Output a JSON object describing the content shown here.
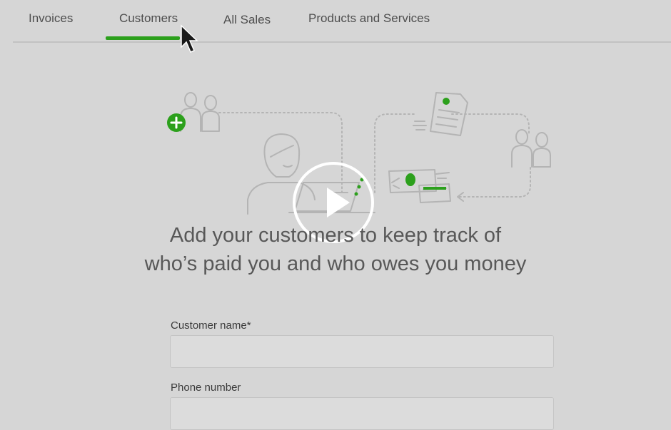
{
  "tabs": [
    {
      "label": "Invoices",
      "active": false
    },
    {
      "label": "Customers",
      "active": true
    },
    {
      "label": "All Sales",
      "active": false
    },
    {
      "label": "Products and Services",
      "active": false
    }
  ],
  "colors": {
    "accent": "#2ca01c",
    "background": "#d6d6d6"
  },
  "icons": [
    "add-customer-icon",
    "customers-icon",
    "woman-at-laptop-icon",
    "invoice-document-icon",
    "payment-card-icon",
    "play-icon",
    "mouse-cursor-icon"
  ],
  "headline": {
    "line1": "Add your customers to keep track of",
    "line2": "who’s paid you and who owes you money"
  },
  "form": {
    "customer_name_label": "Customer name*",
    "customer_name_value": "",
    "phone_label": "Phone number",
    "phone_value": ""
  }
}
